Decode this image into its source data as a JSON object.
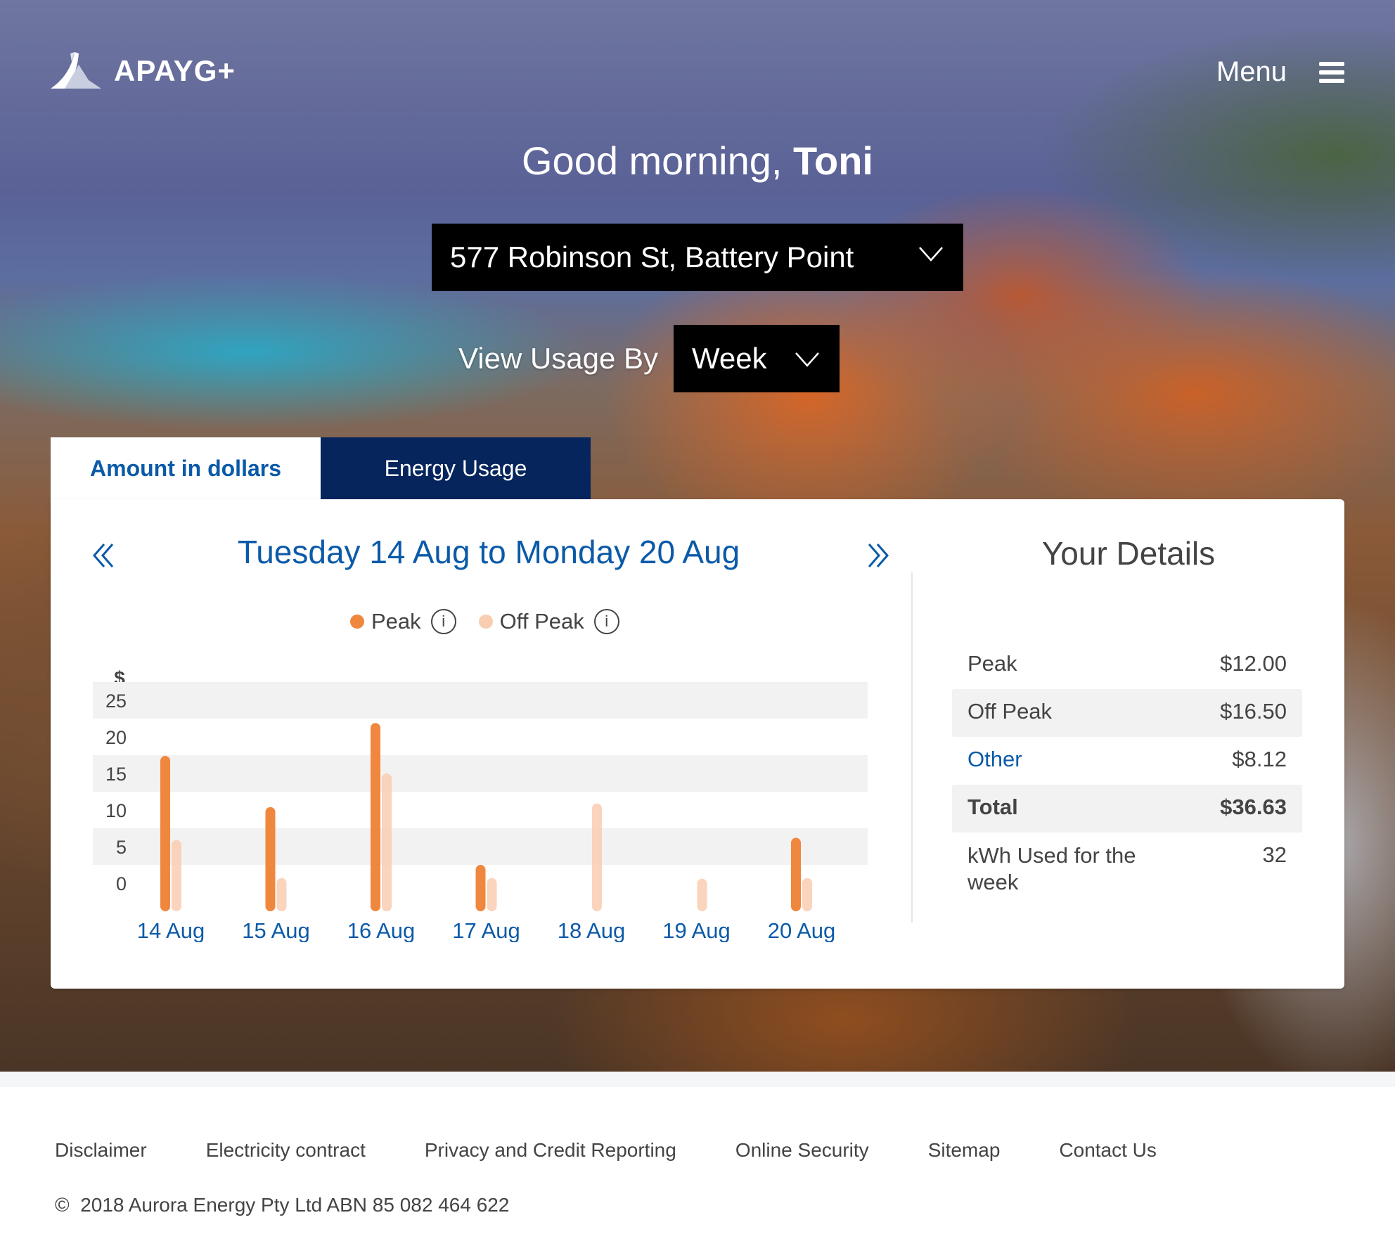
{
  "header": {
    "brand": "APAYG+",
    "menu_label": "Menu"
  },
  "greeting": {
    "prefix": "Good morning, ",
    "name": "Toni"
  },
  "address_select": {
    "value": "577 Robinson St, Battery Point"
  },
  "usage_filter": {
    "label": "View Usage By",
    "value": "Week"
  },
  "tabs": [
    {
      "label": "Amount in dollars",
      "active": true
    },
    {
      "label": "Energy Usage",
      "active": false
    }
  ],
  "period": {
    "title": "Tuesday 14 Aug to Monday 20 Aug"
  },
  "legend": [
    {
      "label": "Peak",
      "color": "#f0873e"
    },
    {
      "label": "Off Peak",
      "color": "#f9cdb0"
    }
  ],
  "chart_data": {
    "type": "bar",
    "title": "",
    "xlabel": "",
    "ylabel": "$",
    "ylim": [
      0,
      25
    ],
    "yticks": [
      25,
      20,
      15,
      10,
      5,
      0
    ],
    "grid": "alternating horizontal bands",
    "legend_position": "top-center",
    "categories": [
      "14 Aug",
      "15 Aug",
      "16 Aug",
      "17 Aug",
      "18 Aug",
      "19 Aug",
      "20 Aug"
    ],
    "series": [
      {
        "name": "Peak",
        "color": "#f0873e",
        "values": [
          17.4,
          10.4,
          21.9,
          2.5,
          0,
          0,
          6.2
        ]
      },
      {
        "name": "Off Peak",
        "color": "#f9cdb0",
        "values": [
          5.9,
          0.7,
          15.0,
          0.7,
          10.9,
          0.6,
          0.7
        ]
      }
    ]
  },
  "details": {
    "title": "Your Details",
    "rows": [
      {
        "label": "Peak",
        "value": "$12.00"
      },
      {
        "label": "Off Peak",
        "value": "$16.50"
      },
      {
        "label": "Other",
        "value": "$8.12"
      },
      {
        "label": "Total",
        "value": "$36.63"
      },
      {
        "label": "kWh Used for the week",
        "value": "32"
      }
    ]
  },
  "footer": {
    "links": [
      "Disclaimer",
      "Electricity contract",
      "Privacy and Credit Reporting",
      "Online Security",
      "Sitemap",
      "Contact Us"
    ],
    "copyright_symbol": "©",
    "copyright": "2018 Aurora Energy Pty Ltd ABN 85 082 464 622"
  },
  "colors": {
    "brand_blue": "#0b5aa8",
    "navy": "#06255d",
    "peak": "#f0873e",
    "off_peak": "#f9cdb0",
    "band": "#f2f2f2"
  }
}
